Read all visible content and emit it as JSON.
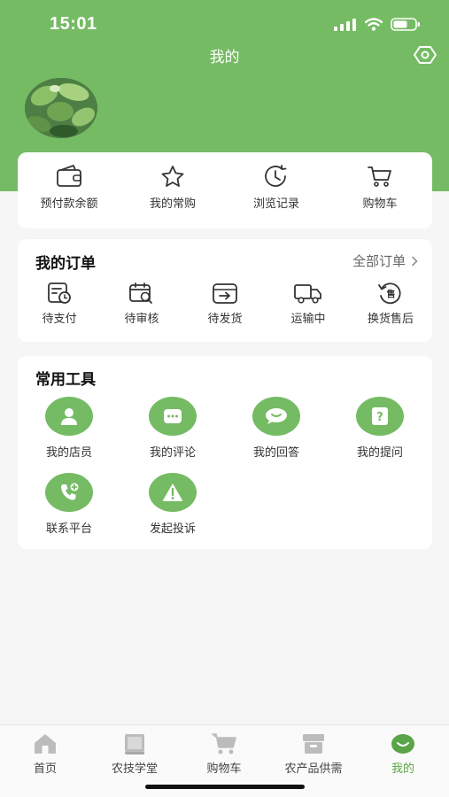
{
  "status_bar": {
    "time": "15:01"
  },
  "header": {
    "title": "我的"
  },
  "quick_links": [
    {
      "label": "预付款余额",
      "icon": "wallet-icon"
    },
    {
      "label": "我的常购",
      "icon": "star-icon"
    },
    {
      "label": "浏览记录",
      "icon": "history-icon"
    },
    {
      "label": "购物车",
      "icon": "cart-icon"
    }
  ],
  "orders": {
    "title": "我的订单",
    "all_label": "全部订单",
    "items": [
      {
        "label": "待支付",
        "icon": "pending-payment-icon"
      },
      {
        "label": "待审核",
        "icon": "pending-review-icon"
      },
      {
        "label": "待发货",
        "icon": "pending-shipment-icon"
      },
      {
        "label": "运输中",
        "icon": "truck-icon"
      },
      {
        "label": "换货售后",
        "icon": "after-sales-icon"
      }
    ]
  },
  "tools": {
    "title": "常用工具",
    "items": [
      {
        "label": "我的店员",
        "icon": "person-icon"
      },
      {
        "label": "我的评论",
        "icon": "comment-icon"
      },
      {
        "label": "我的回答",
        "icon": "answer-icon"
      },
      {
        "label": "我的提问",
        "icon": "question-icon"
      },
      {
        "label": "联系平台",
        "icon": "phone-icon"
      },
      {
        "label": "发起投诉",
        "icon": "warning-icon"
      }
    ]
  },
  "tab_bar": {
    "items": [
      {
        "label": "首页",
        "icon": "home-icon"
      },
      {
        "label": "农技学堂",
        "icon": "book-icon"
      },
      {
        "label": "购物车",
        "icon": "cart-icon"
      },
      {
        "label": "农产品供需",
        "icon": "box-icon"
      },
      {
        "label": "我的",
        "icon": "smile-icon"
      }
    ],
    "active_index": 4
  },
  "colors": {
    "brand_green": "#75bb64",
    "active_tab": "#5aa447"
  }
}
